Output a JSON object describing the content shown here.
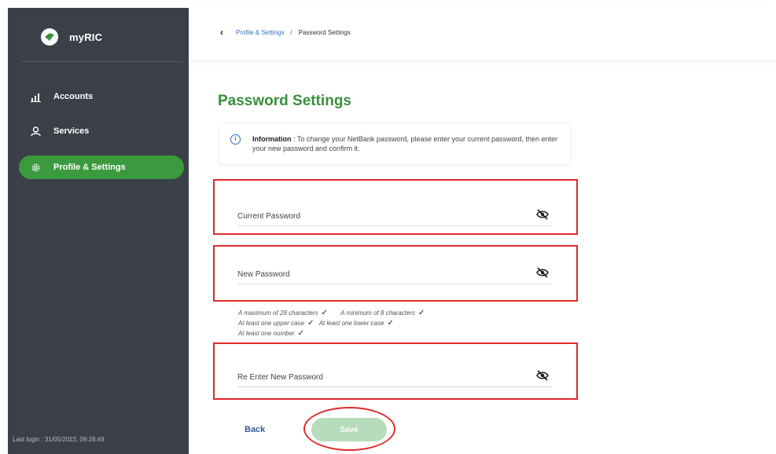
{
  "app": {
    "name": "myRIC"
  },
  "sidebar": {
    "items": [
      {
        "label": "Accounts",
        "icon": "accounts-icon",
        "active": false
      },
      {
        "label": "Services",
        "icon": "services-icon",
        "active": false
      },
      {
        "label": "Profile & Settings",
        "icon": "gear-icon",
        "active": true
      }
    ],
    "last_login": "Last login : 31/05/2023, 09:28:49"
  },
  "breadcrumb": {
    "parent": "Profile & Settings",
    "separator": "/",
    "current": "Password Settings"
  },
  "page": {
    "title": "Password Settings",
    "info_label": "Information",
    "info_text": ": To change your NetBank password, please enter your current password, then enter your new password and confirm it."
  },
  "form": {
    "current_password_label": "Current Password",
    "new_password_label": "New Password",
    "reenter_password_label": "Re Enter New Password",
    "rules": [
      "A maximum of 28 characters",
      "A minimum of 8 characters",
      "At least one upper case",
      "At least one lower case",
      "At least one number"
    ],
    "back_label": "Back",
    "save_label": "Save"
  },
  "colors": {
    "sidebar_bg": "#3b4048",
    "accent_green": "#3c9a3e",
    "title_green": "#3a8f3c",
    "save_disabled": "#b7dcbc",
    "highlight_red": "#e02a2a"
  }
}
